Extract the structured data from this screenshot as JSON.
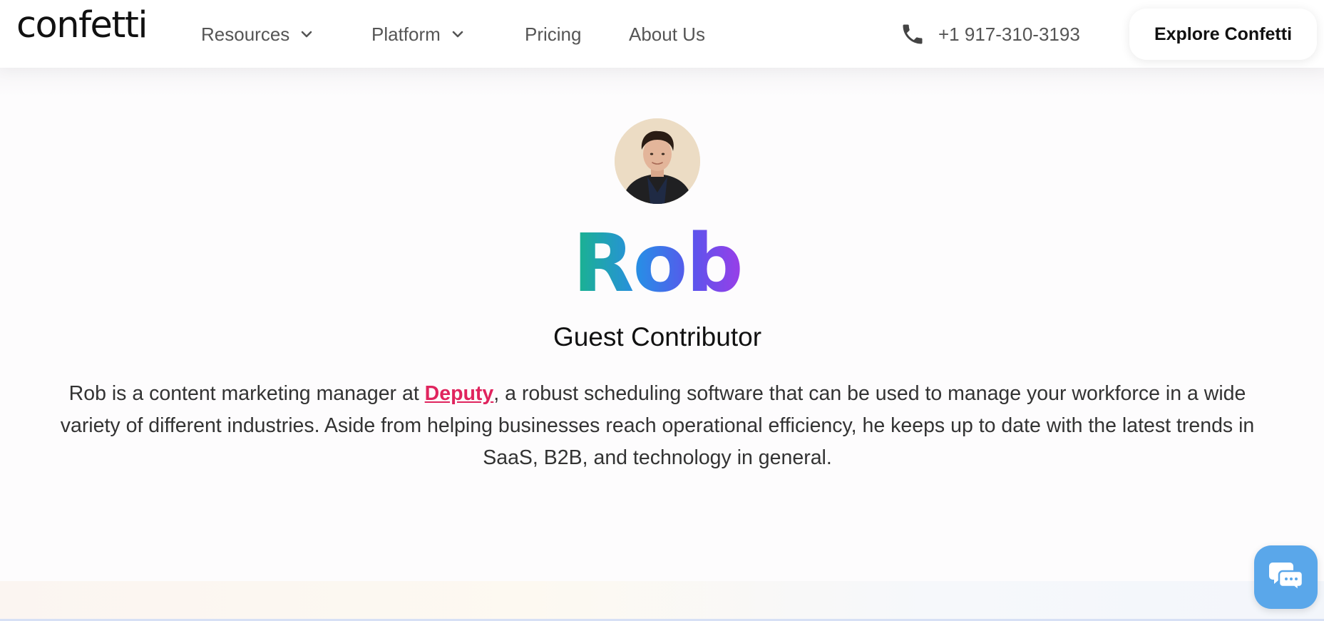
{
  "header": {
    "logo": "confetti",
    "nav": [
      {
        "label": "Resources",
        "has_dropdown": true
      },
      {
        "label": "Platform",
        "has_dropdown": true
      },
      {
        "label": "Pricing",
        "has_dropdown": false
      },
      {
        "label": "About Us",
        "has_dropdown": false
      }
    ],
    "phone": "+1 917-310-3193",
    "phone_icon": "phone-icon",
    "cta_label": "Explore Confetti"
  },
  "author": {
    "name": "Rob",
    "role": "Guest Contributor",
    "bio_before": "Rob is a content marketing manager at ",
    "bio_link": "Deputy",
    "bio_after": ", a robust scheduling software that can be used to manage your workforce in a wide variety of different industries. Aside from helping businesses reach operational efficiency, he keeps up to date with the latest trends in SaaS, B2B, and technology in general."
  },
  "chat": {
    "icon": "chat-bubbles-icon"
  },
  "colors": {
    "accent_link": "#e0245e",
    "chat_button": "#5aa7ea",
    "name_gradient": [
      "#19b58a",
      "#2a8be6",
      "#5a55ec",
      "#9a3ee8"
    ]
  }
}
